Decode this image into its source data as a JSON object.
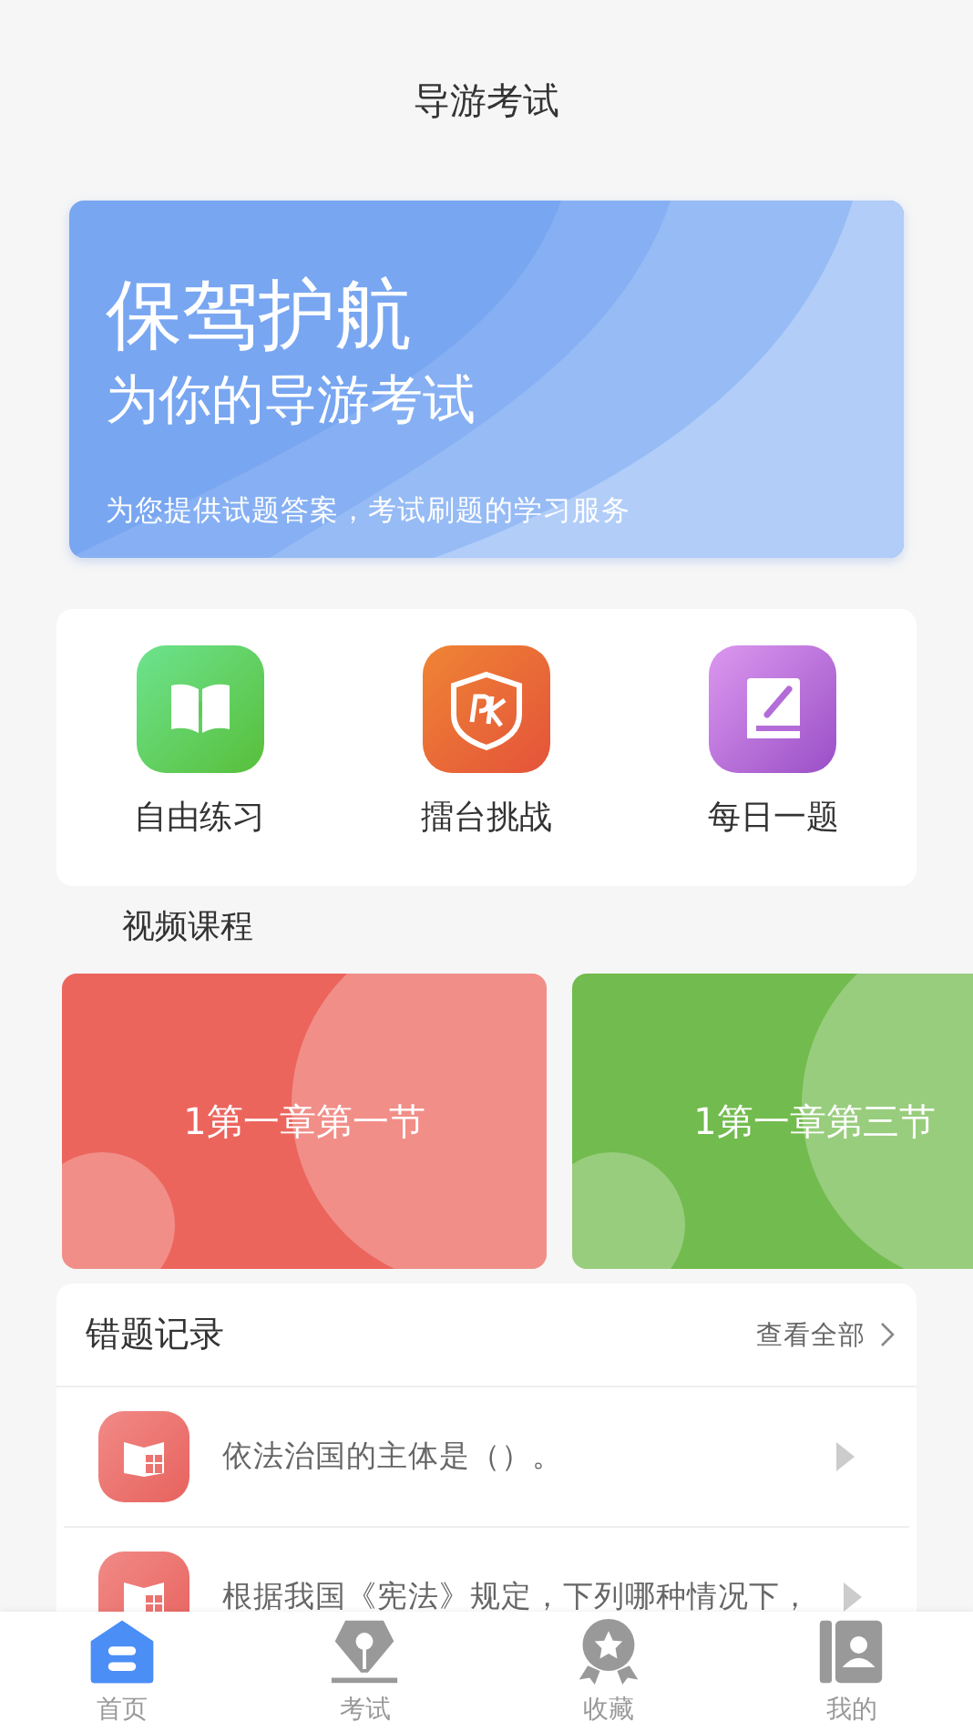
{
  "header": {
    "title": "导游考试"
  },
  "banner": {
    "title": "保驾护航",
    "subtitle": "为你的导游考试",
    "caption": "为您提供试题答案，考试刷题的学习服务"
  },
  "shortcuts": [
    {
      "kind": "book",
      "label": "自由练习"
    },
    {
      "kind": "pk",
      "label": "擂台挑战"
    },
    {
      "kind": "note",
      "label": "每日一题"
    }
  ],
  "video_section": {
    "title": "视频课程",
    "courses": [
      {
        "title": "1第一章第一节",
        "color": "#ec655d"
      },
      {
        "title": "1第一章第三节",
        "color": "#72bb4e"
      }
    ]
  },
  "mistakes": {
    "title": "错题记录",
    "link": "查看全部",
    "items": [
      {
        "question": "依法治国的主体是（）。"
      },
      {
        "question": "根据我国《宪法》规定，下列哪种情况下，"
      }
    ]
  },
  "tabbar": [
    {
      "kind": "home",
      "label": "首页",
      "selected": true
    },
    {
      "kind": "exam",
      "label": "考试",
      "selected": false
    },
    {
      "kind": "fav",
      "label": "收藏",
      "selected": false
    },
    {
      "kind": "me",
      "label": "我的",
      "selected": false
    }
  ]
}
